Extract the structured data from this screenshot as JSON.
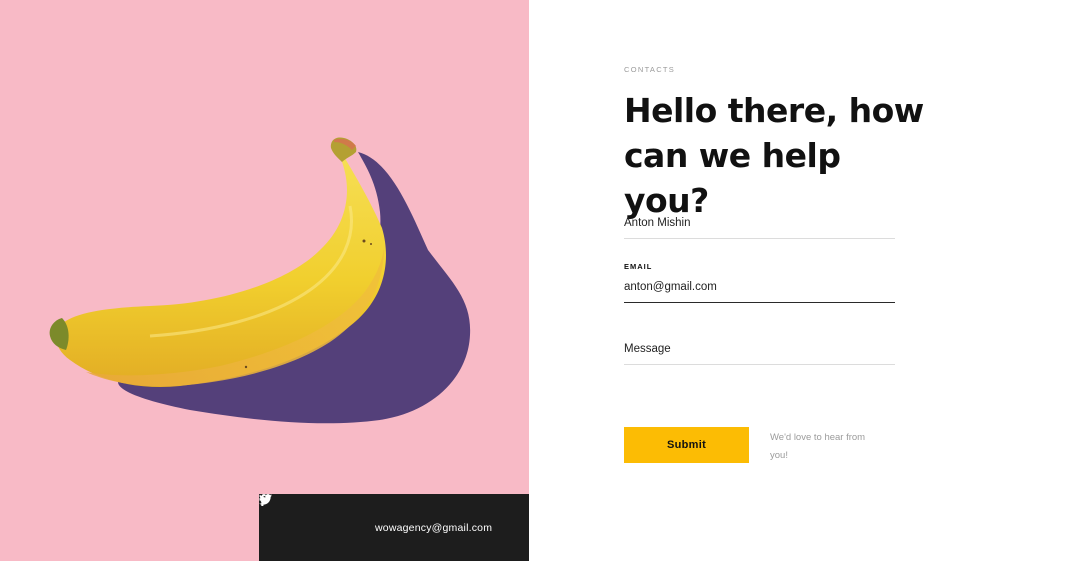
{
  "contact": {
    "section_label": "CONTACTS",
    "headline": "Hello there, how can we help you?",
    "fields": {
      "name": {
        "value": "",
        "placeholder": "Anton Mishin"
      },
      "email": {
        "label": "EMAIL",
        "value": "anton@gmail.com",
        "placeholder": ""
      },
      "message": {
        "value": "",
        "placeholder": "Message"
      }
    },
    "submit_label": "Submit",
    "helper_note": "We'd love to hear from you!"
  },
  "footer": {
    "email": "wowagency@gmail.com",
    "social": [
      {
        "icon": "twitter-icon"
      },
      {
        "icon": "facebook-icon"
      }
    ]
  },
  "colors": {
    "hero_background": "#f8bac6",
    "banana_yellow": "#f4d43a",
    "shadow_purple": "#54407a",
    "footer_bar": "#1d1d1d",
    "accent_button": "#fcbc04"
  }
}
